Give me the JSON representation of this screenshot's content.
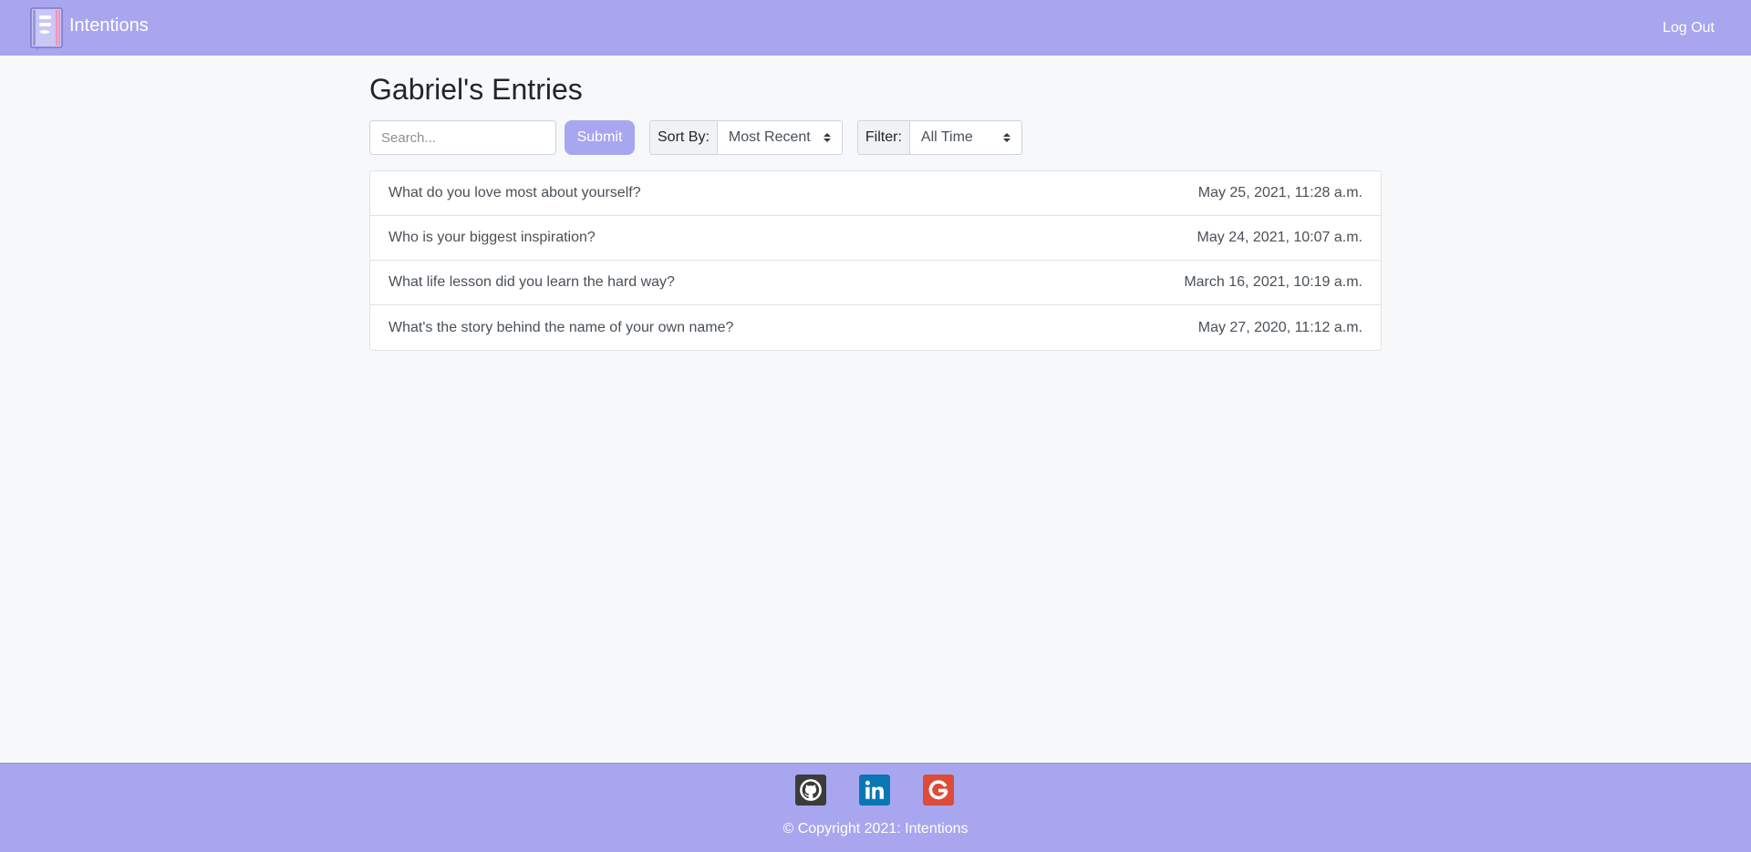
{
  "navbar": {
    "brand_name": "Intentions",
    "logout_label": "Log Out"
  },
  "main": {
    "title": "Gabriel's Entries",
    "search": {
      "placeholder": "Search...",
      "value": ""
    },
    "submit_label": "Submit",
    "sort": {
      "label": "Sort By:",
      "selected": "Most Recent"
    },
    "filter": {
      "label": "Filter:",
      "selected": "All Time"
    },
    "entries": [
      {
        "question": "What do you love most about yourself?",
        "date": "May 25, 2021, 11:28 a.m."
      },
      {
        "question": "Who is your biggest inspiration?",
        "date": "May 24, 2021, 10:07 a.m."
      },
      {
        "question": "What life lesson did you learn the hard way?",
        "date": "March 16, 2021, 10:19 a.m."
      },
      {
        "question": "What's the story behind the name of your own name?",
        "date": "May 27, 2020, 11:12 a.m."
      }
    ]
  },
  "footer": {
    "social_icons": [
      "github-icon",
      "linkedin-icon",
      "google-icon"
    ],
    "copyright": "© Copyright 2021: Intentions"
  },
  "colors": {
    "brand": "#a8a6ef",
    "background": "#f7f8fa",
    "github": "#3b3b3b",
    "linkedin": "#0a77b5",
    "google": "#dd4b39"
  }
}
